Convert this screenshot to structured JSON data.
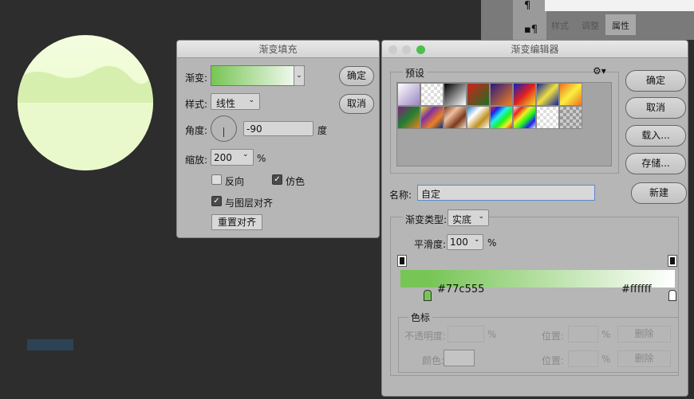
{
  "right_panel": {
    "tabs": [
      "样式",
      "调整",
      "属性"
    ]
  },
  "gradient_fill": {
    "title": "渐变填充",
    "gradient_label": "渐变:",
    "style_label": "样式:",
    "style_value": "线性",
    "angle_label": "角度:",
    "angle_value": "-90",
    "angle_unit": "度",
    "scale_label": "缩放:",
    "scale_value": "200",
    "scale_unit": "%",
    "reverse_label": "反向",
    "reverse_checked": false,
    "dither_label": "仿色",
    "dither_checked": true,
    "align_label": "与图层对齐",
    "align_checked": true,
    "reset_align": "重置对齐",
    "ok": "确定",
    "cancel": "取消"
  },
  "gradient_editor": {
    "title": "渐变编辑器",
    "presets_label": "预设",
    "gear_icon": "gear-icon",
    "ok": "确定",
    "cancel": "取消",
    "load": "载入...",
    "save": "存储...",
    "new": "新建",
    "name_label": "名称:",
    "name_value": "自定",
    "type_label": "渐变类型:",
    "type_value": "实底",
    "smooth_label": "平滑度:",
    "smooth_value": "100",
    "smooth_unit": "%",
    "stop_left_color": "#77c555",
    "stop_right_color": "#ffffff",
    "stop_left_text": "#77c555",
    "stop_right_text": "#ffffff",
    "stops_group": "色标",
    "opacity_label": "不透明度:",
    "opacity_unit": "%",
    "position_label": "位置:",
    "position_unit": "%",
    "delete": "删除",
    "color_label": "颜色:"
  }
}
